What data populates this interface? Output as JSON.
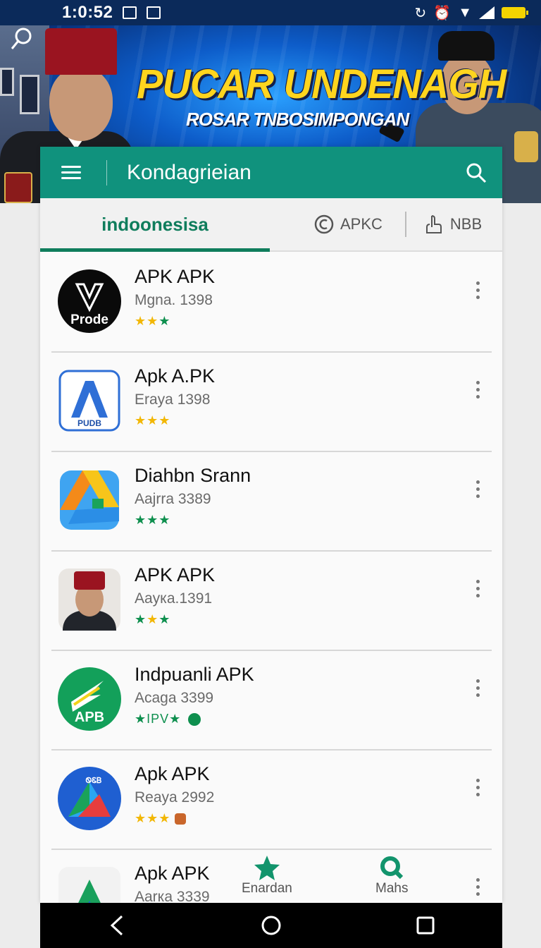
{
  "status": {
    "time": "1:0:52"
  },
  "banner": {
    "title": "PUCAR UNDENAGH",
    "subtitle": "ROSAR TNBOSIMPONGAN"
  },
  "toolbar": {
    "title": "Kondagrieian"
  },
  "tabs": [
    {
      "label": "indoonesisa",
      "icon": "none"
    },
    {
      "label": "APKC",
      "icon": "app-icon"
    },
    {
      "label": "NBB",
      "icon": "hand-icon"
    }
  ],
  "apps": [
    {
      "name": "APK APK",
      "meta": "Mgna. 1398",
      "rating": "★★★",
      "icon_text": "Prode",
      "icon_style": "black-shield"
    },
    {
      "name": "Apk A.PK",
      "meta": "Eraya 1398",
      "rating": "★★★",
      "icon_text": "PUDB",
      "icon_style": "blue-a"
    },
    {
      "name": "Diahbn Srann",
      "meta": "Aajrra 3389",
      "rating": "★★★",
      "icon_text": "",
      "icon_style": "drive"
    },
    {
      "name": "APK APK",
      "meta": "Aayка.1391",
      "rating": "★★★",
      "icon_text": "",
      "icon_style": "portrait"
    },
    {
      "name": "Indpuanli APK",
      "meta": "Acaga 3399",
      "rating": "★IPV★",
      "icon_text": "APB",
      "icon_style": "green-apb"
    },
    {
      "name": "Apk APK",
      "meta": "Reaya 2992",
      "rating": "★★★",
      "icon_text": "ᏫᏋᏴ",
      "icon_style": "blue-play"
    },
    {
      "name": "Apk APK",
      "meta": "Aarка 3339",
      "rating": "",
      "icon_text": "",
      "icon_style": "green-tri"
    }
  ],
  "bottom_nav": [
    {
      "label": "Enardan",
      "icon": "star-icon"
    },
    {
      "label": "Mahs",
      "icon": "search-icon"
    }
  ],
  "colors": {
    "accent": "#10927d",
    "tab_active": "#0f7d5c",
    "star_yellow": "#f2b705",
    "star_green": "#0e8f4e"
  }
}
